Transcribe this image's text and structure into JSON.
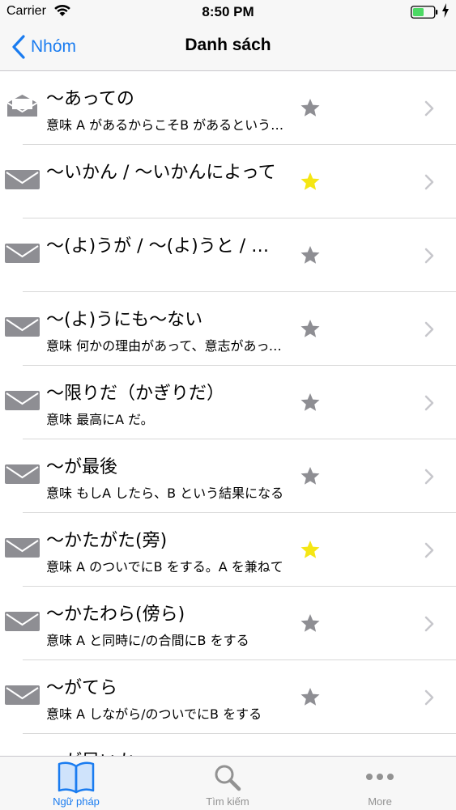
{
  "status_bar": {
    "carrier": "Carrier",
    "time": "8:50 PM"
  },
  "nav": {
    "back_label": "Nhóm",
    "title": "Danh sách"
  },
  "items": [
    {
      "title": "〜あっての",
      "subtitle": "意味 A があるからこそB があるという…",
      "starred": false,
      "read": true
    },
    {
      "title": "〜いかん / 〜いかんによって",
      "subtitle": "",
      "starred": true,
      "read": false
    },
    {
      "title": "〜(よ)うが / 〜(よ)うと / 〜(よ)うが",
      "subtitle": "",
      "starred": false,
      "read": false
    },
    {
      "title": "〜(よ)うにも〜ない",
      "subtitle": "意味 何かの理由があって、意志があっても",
      "starred": false,
      "read": false
    },
    {
      "title": "〜限りだ（かぎりだ）",
      "subtitle": "意味 最高にA だ。",
      "starred": false,
      "read": false
    },
    {
      "title": "〜が最後",
      "subtitle": "意味 もしA したら、B という結果になる",
      "starred": false,
      "read": false
    },
    {
      "title": "〜かたがた(旁)",
      "subtitle": "意味 A のついでにB をする。A を兼ねて",
      "starred": true,
      "read": false
    },
    {
      "title": "〜かたわら(傍ら)",
      "subtitle": "意味 A と同時に/の合間にB をする",
      "starred": false,
      "read": false
    },
    {
      "title": "〜がてら",
      "subtitle": "意味 A しながら/のついでにB をする",
      "starred": false,
      "read": false
    },
    {
      "title": "〜が早いか",
      "subtitle": "",
      "starred": false,
      "read": false
    }
  ],
  "tabs": [
    {
      "label": "Ngữ pháp",
      "icon": "book-icon",
      "active": true
    },
    {
      "label": "Tìm kiếm",
      "icon": "search-icon",
      "active": false
    },
    {
      "label": "More",
      "icon": "more-icon",
      "active": false
    }
  ],
  "colors": {
    "accent": "#1a7cf0",
    "star_on": "#f5e614",
    "star_off": "#8e8e93",
    "icon_gray": "#8e8e93",
    "chevron": "#c7c7cc",
    "battery": "#4cd964"
  }
}
